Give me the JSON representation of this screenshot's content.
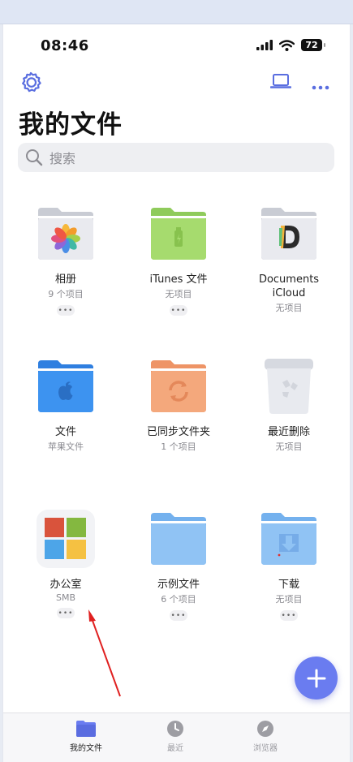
{
  "status": {
    "time": "08:46",
    "battery": "72"
  },
  "header": {
    "title": "我的文件"
  },
  "search": {
    "placeholder": "搜索"
  },
  "items": [
    {
      "label": "相册",
      "sub": "9 个项目",
      "icon": "photos-folder-icon"
    },
    {
      "label": "iTunes 文件",
      "sub": "无项目",
      "icon": "itunes-folder-icon"
    },
    {
      "label": "Documents iCloud",
      "sub": "无项目",
      "icon": "documents-icloud-folder-icon"
    },
    {
      "label": "文件",
      "sub": "苹果文件",
      "icon": "apple-files-folder-icon"
    },
    {
      "label": "已同步文件夹",
      "sub": "1 个项目",
      "icon": "sync-folder-icon"
    },
    {
      "label": "最近删除",
      "sub": "无项目",
      "icon": "trash-icon"
    },
    {
      "label": "办公室",
      "sub": "SMB",
      "icon": "smb-windows-icon"
    },
    {
      "label": "示例文件",
      "sub": "6 个项目",
      "icon": "sample-folder-icon"
    },
    {
      "label": "下载",
      "sub": "无项目",
      "icon": "download-folder-icon"
    }
  ],
  "tabs": [
    {
      "label": "我的文件",
      "icon": "folder-icon",
      "active": true
    },
    {
      "label": "最近",
      "icon": "clock-icon",
      "active": false
    },
    {
      "label": "浏览器",
      "icon": "compass-icon",
      "active": false
    }
  ],
  "colors": {
    "accent": "#6a7cf0",
    "annotation": "#e02020"
  }
}
